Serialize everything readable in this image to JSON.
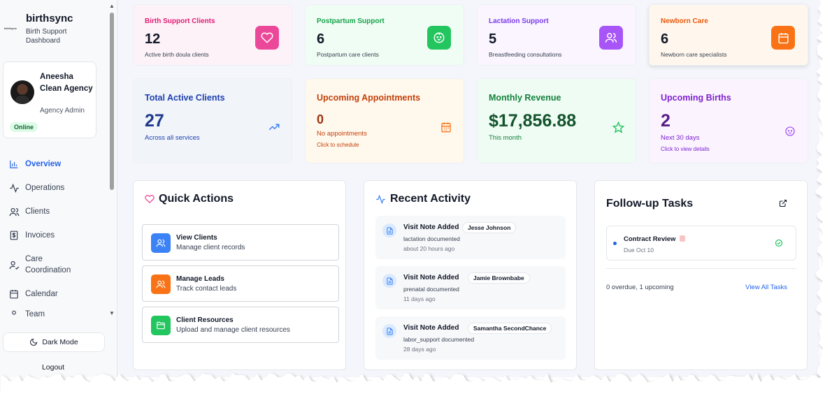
{
  "brand": {
    "logo_text": "birthsync",
    "name": "birthsync",
    "subtitle": "Birth Support Dashboard"
  },
  "profile": {
    "name": "Aneesha Clean Agency",
    "role": "Agency Admin",
    "status": "Online"
  },
  "nav": {
    "items": [
      {
        "label": "Overview",
        "icon": "bar-chart-icon"
      },
      {
        "label": "Operations",
        "icon": "activity-icon"
      },
      {
        "label": "Clients",
        "icon": "users-icon"
      },
      {
        "label": "Invoices",
        "icon": "receipt-icon"
      },
      {
        "label": "Care Coordination",
        "icon": "user-check-icon"
      },
      {
        "label": "Calendar",
        "icon": "calendar-icon"
      },
      {
        "label": "Team",
        "icon": "team-icon"
      }
    ]
  },
  "sidebar_footer": {
    "dark_mode": "Dark Mode",
    "logout": "Logout"
  },
  "stats": [
    {
      "label": "Birth Support Clients",
      "value": "12",
      "desc": "Active birth doula clients",
      "color": "#e11d74",
      "bg": "#fdf2f8",
      "badge": "#ec4899",
      "icon": "heart-icon"
    },
    {
      "label": "Postpartum Support",
      "value": "6",
      "desc": "Postpartum care clients",
      "color": "#16a34a",
      "bg": "#f0fdf4",
      "badge": "#22c55e",
      "icon": "baby-icon"
    },
    {
      "label": "Lactation Support",
      "value": "5",
      "desc": "Breastfeeding consultations",
      "color": "#7c3aed",
      "bg": "#faf5ff",
      "badge": "#a855f7",
      "icon": "users-icon"
    },
    {
      "label": "Newborn Care",
      "value": "6",
      "desc": "Newborn care specialists",
      "color": "#ea580c",
      "bg": "#fff7ed",
      "badge": "#f97316",
      "icon": "calendar-icon"
    }
  ],
  "summary": [
    {
      "label": "Total Active Clients",
      "value": "27",
      "desc": "Across all services",
      "hint": "",
      "color": "#1e40af",
      "value_color": "#1e3a8a",
      "bg": "#f1f4f9",
      "icon": "trending-up-icon"
    },
    {
      "label": "Upcoming Appointments",
      "value": "0",
      "desc": "No appointments",
      "hint": "Click to schedule",
      "color": "#c2410c",
      "value_color": "#9a3412",
      "bg": "#fff8ec",
      "icon": "calendar-icon"
    },
    {
      "label": "Monthly Revenue",
      "value": "$17,856.88",
      "desc": "This month",
      "hint": "",
      "color": "#15803d",
      "value_color": "#14532d",
      "bg": "#effcf3",
      "icon": "star-icon"
    },
    {
      "label": "Upcoming Births",
      "value": "2",
      "desc": "Next 30 days",
      "hint": "Click to view details",
      "color": "#7e22ce",
      "value_color": "#581c87",
      "bg": "#fbf4ff",
      "icon": "baby-icon"
    }
  ],
  "quick_actions": {
    "title": "Quick Actions",
    "items": [
      {
        "title": "View Clients",
        "sub": "Manage client records",
        "color": "#3b82f6"
      },
      {
        "title": "Manage Leads",
        "sub": "Track contact leads",
        "color": "#f97316"
      },
      {
        "title": "Client Resources",
        "sub": "Upload and manage client resources",
        "color": "#22c55e"
      }
    ]
  },
  "recent_activity": {
    "title": "Recent Activity",
    "items": [
      {
        "title": "Visit Note Added",
        "name": "Jesse Johnson",
        "note": "lactation documented",
        "time": "about 20 hours ago"
      },
      {
        "title": "Visit Note Added",
        "name": "Jamie Brownbabe",
        "note": "prenatal documented",
        "time": "11 days ago"
      },
      {
        "title": "Visit Note Added",
        "name": "Samantha SecondChance",
        "note": "labor_support documented",
        "time": "28 days ago"
      }
    ]
  },
  "followup": {
    "title": "Follow-up Tasks",
    "task_title": "Contract Review",
    "task_due": "Due Oct 10",
    "summary": "0 overdue, 1 upcoming",
    "view_all": "View All Tasks"
  }
}
